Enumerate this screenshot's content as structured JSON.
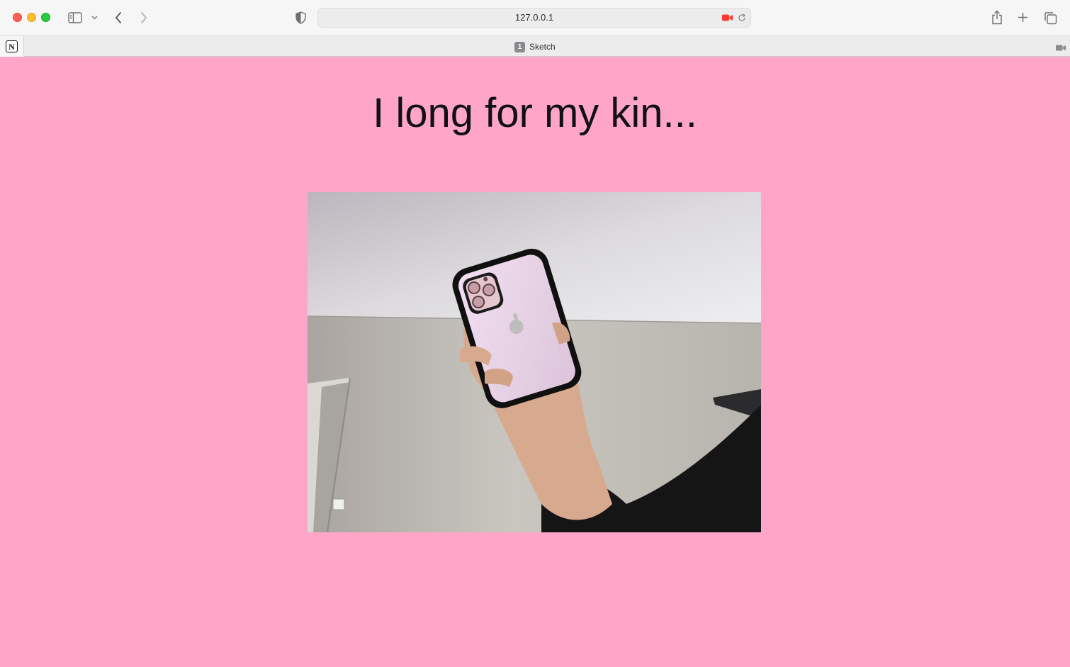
{
  "browser": {
    "url": "127.0.0.1",
    "tabs": [
      {
        "badge": "1",
        "title": "Sketch",
        "active": true
      }
    ],
    "icons": {
      "sidebar": "sidebar-icon",
      "sidebar_menu": "chevron-down-icon",
      "back": "chevron-left-icon",
      "forward": "chevron-right-icon",
      "privacy": "shield-icon",
      "camera_in_use": "video-camera-icon",
      "reload": "reload-icon",
      "share": "share-icon",
      "new_tab": "plus-icon",
      "tab_overview": "tabs-overview-icon",
      "pinned_tab": "notion-icon"
    },
    "colors": {
      "camera_indicator": "#ff3b30"
    }
  },
  "page": {
    "heading": "I long for my kin...",
    "background": "#ffa6c8",
    "video_feed": "webcam-feed"
  }
}
